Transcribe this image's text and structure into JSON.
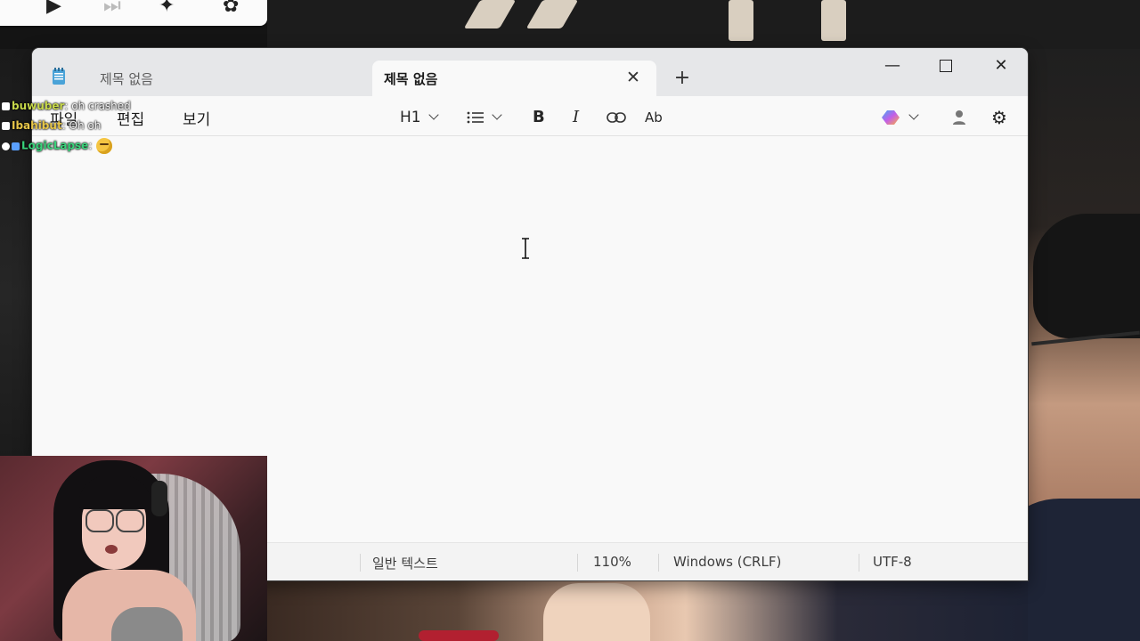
{
  "notepad": {
    "tabs": [
      {
        "label": "제목 없음",
        "active": false
      },
      {
        "label": "제목 없음",
        "active": true
      }
    ],
    "tab_close_glyph": "✕",
    "new_tab_glyph": "+",
    "window_controls": {
      "minimize": "—",
      "close": "✕"
    },
    "menu": [
      "파일",
      "편집",
      "보기"
    ],
    "toolbar": {
      "heading": "H1",
      "list_icon": "≔",
      "bold": "B",
      "italic": "I",
      "link_icon": "⛓",
      "spellcheck": "Ab"
    },
    "status": {
      "format": "일반 텍스트",
      "zoom": "110%",
      "line_ending": "Windows (CRLF)",
      "encoding": "UTF-8"
    }
  },
  "chat": [
    {
      "user": "buwuber",
      "message": ": oh crashed",
      "color": "#c7d84a"
    },
    {
      "user": "Ibahibut",
      "message": ": Oh oh",
      "color": "#e8c74a"
    },
    {
      "user": "LogicLapse",
      "message": ":",
      "color": "#39d27a"
    }
  ],
  "colors": {
    "titlebar": "#e6e7e9",
    "editor_bg": "#f9f9f9",
    "copilot_gradient": [
      "#3fa9f5",
      "#c35ee8",
      "#ffb13b"
    ]
  }
}
